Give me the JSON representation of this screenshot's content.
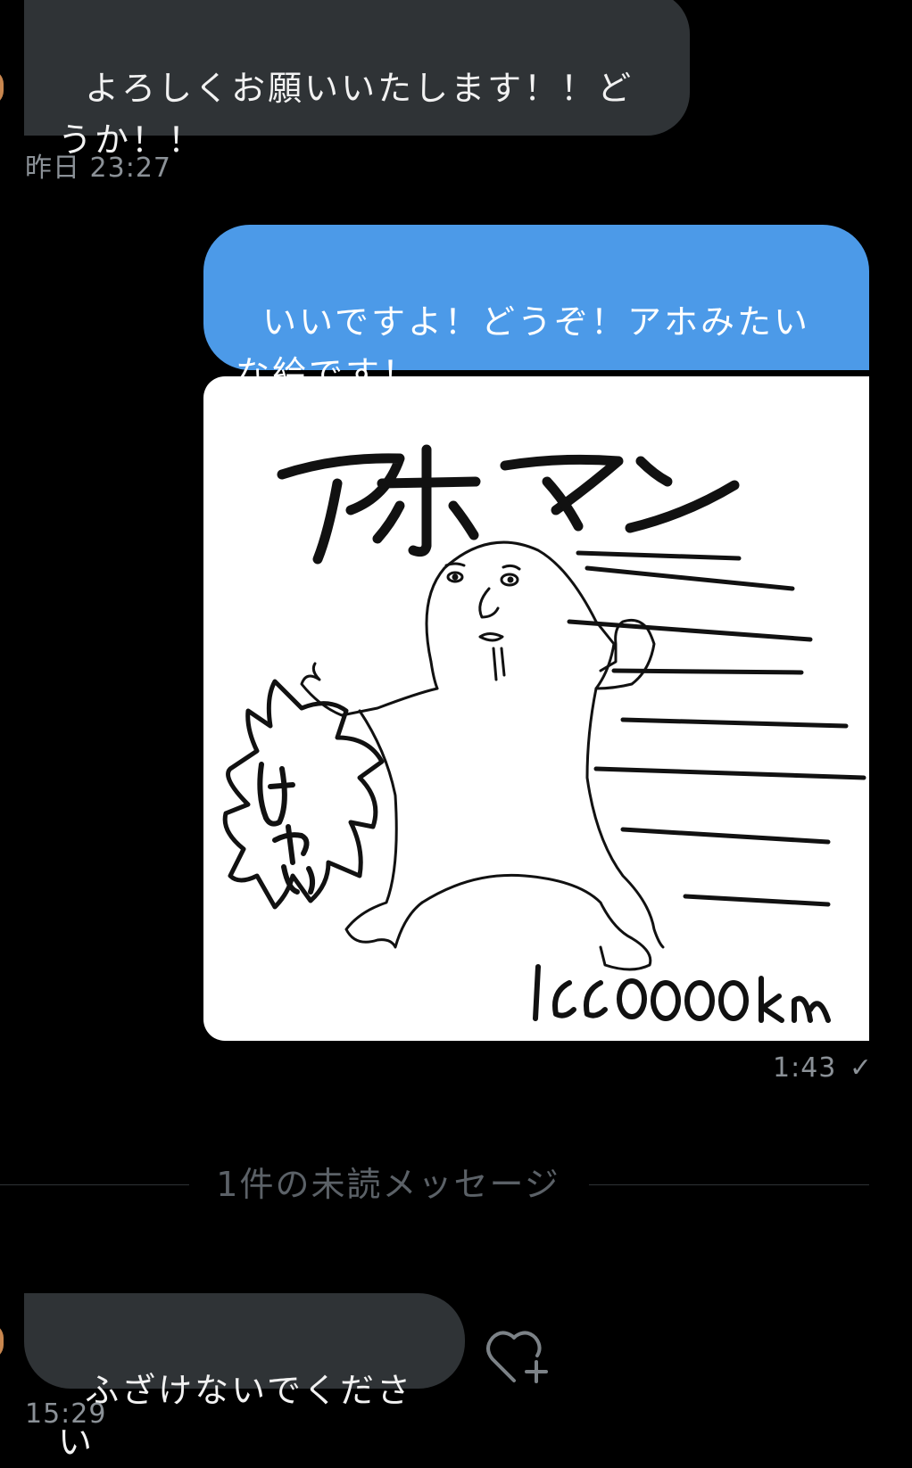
{
  "messages": [
    {
      "id": "m1",
      "direction": "incoming",
      "text": "よろしくお願いいたします！！どうか！！",
      "time": "昨日 23:27"
    },
    {
      "id": "m2",
      "direction": "outgoing",
      "text": "いいですよ！どうぞ！アホみたいな絵です！"
    },
    {
      "id": "m3",
      "direction": "outgoing",
      "image": {
        "title_text": "アホマン",
        "shout_text": "はやい",
        "speed_text": "100000km"
      },
      "time": "1:43",
      "status_icon": "check-icon"
    },
    {
      "id": "m4",
      "direction": "incoming",
      "text": "ふざけないでください",
      "time": "15:29"
    }
  ],
  "unread_divider": {
    "label": "1件の未読メッセージ"
  },
  "reaction": {
    "icon": "heart-plus-icon"
  },
  "colors": {
    "background": "#000000",
    "incoming_bubble": "#2f3336",
    "outgoing_bubble": "#4c9ae8",
    "meta_text": "#8b9197",
    "divider_text": "#5b6167"
  }
}
